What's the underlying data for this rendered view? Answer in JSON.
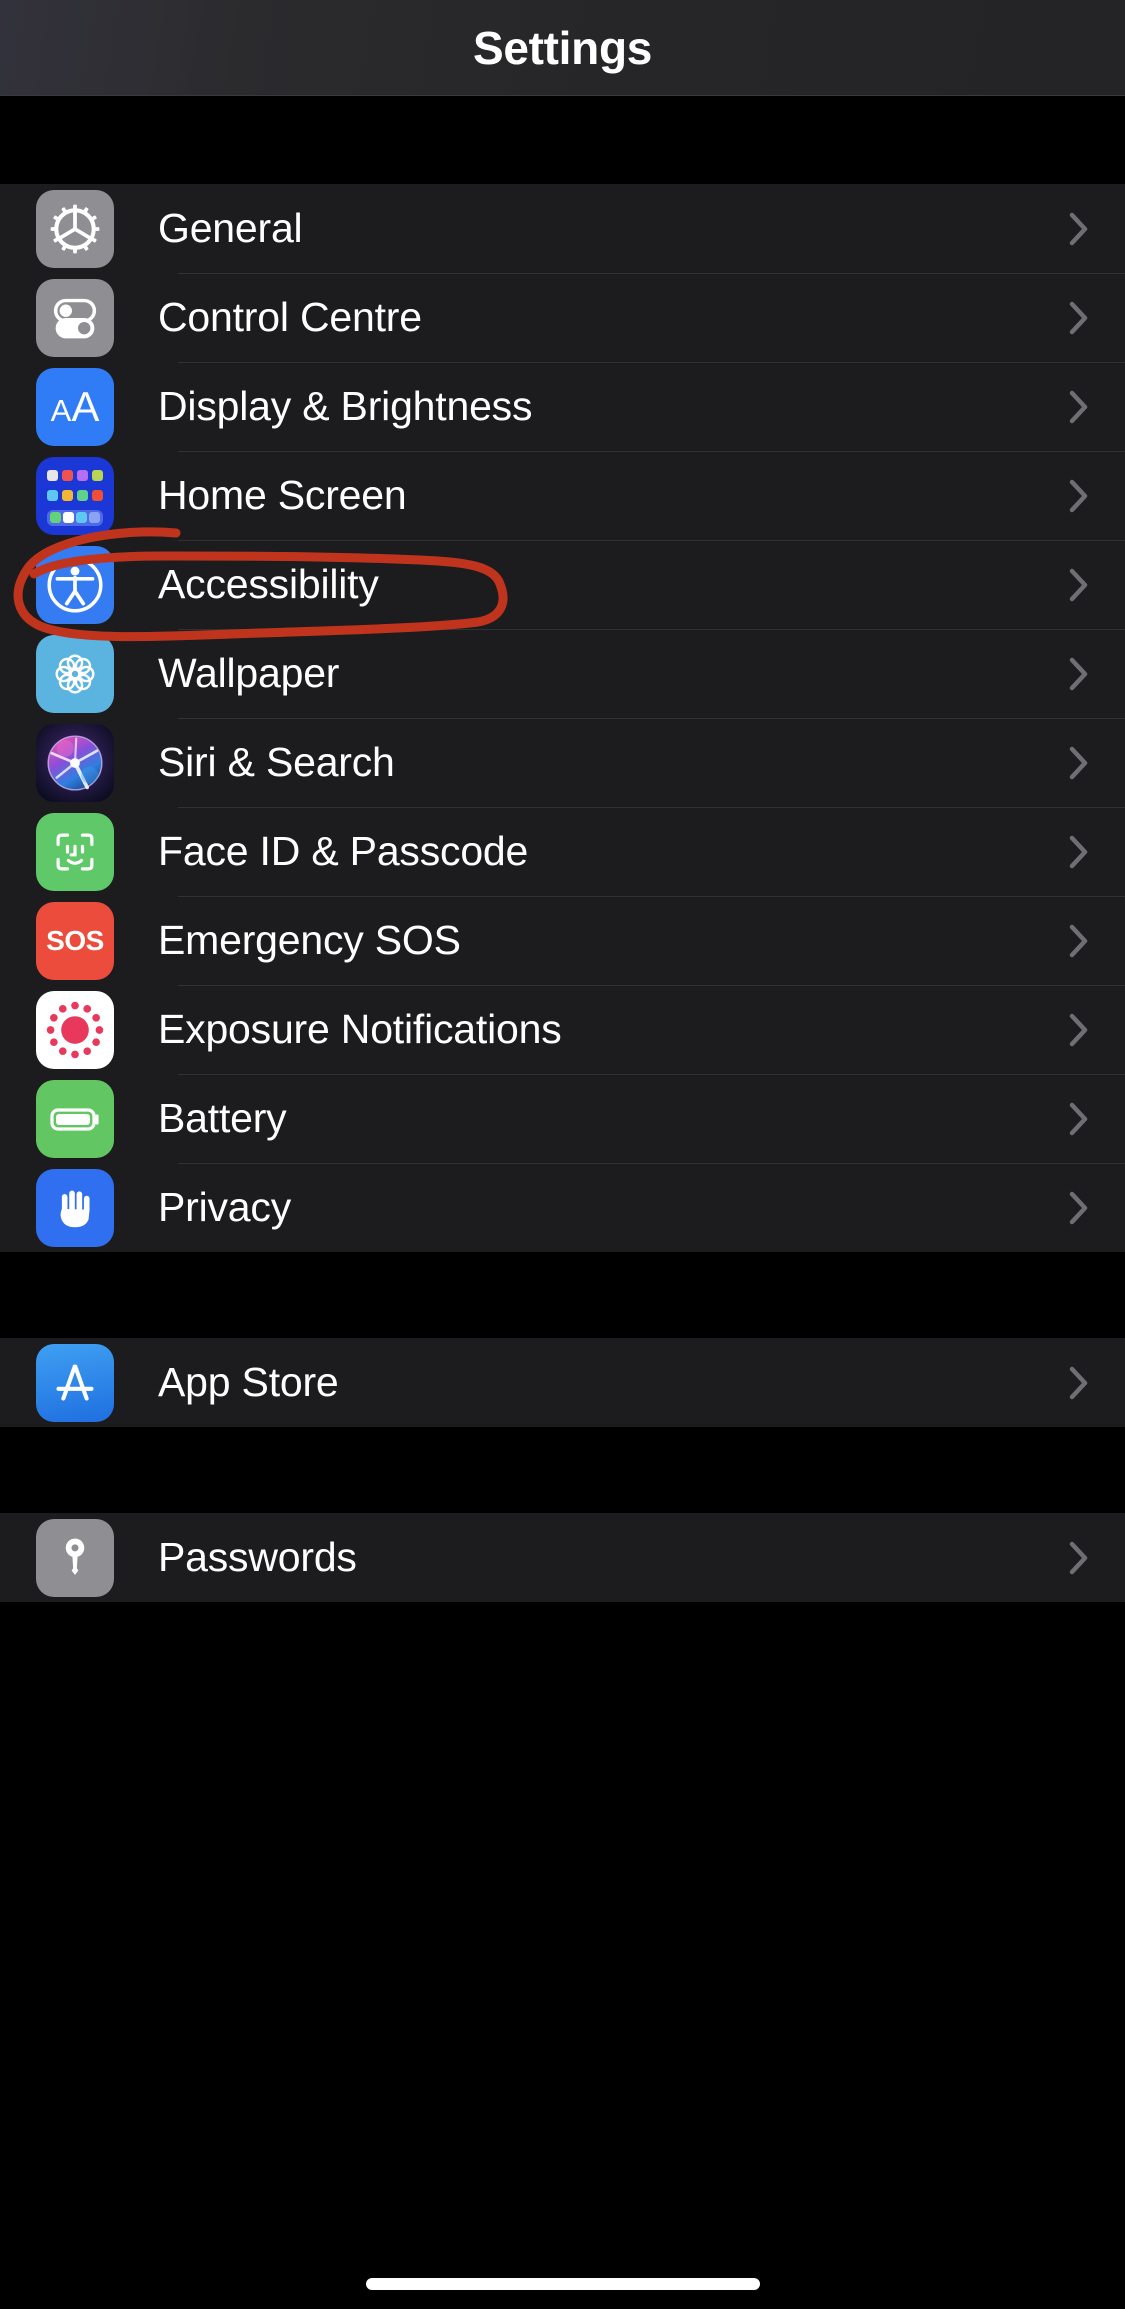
{
  "header": {
    "title": "Settings"
  },
  "colors": {
    "background": "#000000",
    "row_background": "#1c1c1e",
    "separator": "#313134",
    "label_text": "#ffffff",
    "chevron": "#6e6e73",
    "annotation_red": "#c0341d",
    "accent_blue": "#2f7cf6",
    "gray_icon": "#8e8e93",
    "green_icon": "#5fc96a",
    "red_icon": "#ec4c3b"
  },
  "groups": [
    {
      "name": "system-group",
      "rows": [
        {
          "label": "General",
          "icon": "gear-icon",
          "icon_class": "ic-general",
          "chevron": true
        },
        {
          "label": "Control Centre",
          "icon": "toggles-icon",
          "icon_class": "ic-control",
          "chevron": true
        },
        {
          "label": "Display & Brightness",
          "icon": "display-brightness-icon",
          "icon_class": "ic-display",
          "chevron": true
        },
        {
          "label": "Home Screen",
          "icon": "home-screen-grid-icon",
          "icon_class": "ic-home",
          "chevron": true
        },
        {
          "label": "Accessibility",
          "icon": "accessibility-person-icon",
          "icon_class": "ic-access",
          "chevron": true
        },
        {
          "label": "Wallpaper",
          "icon": "wallpaper-flower-icon",
          "icon_class": "ic-wallpaper",
          "chevron": true
        },
        {
          "label": "Siri & Search",
          "icon": "siri-orb-icon",
          "icon_class": "ic-siri",
          "chevron": true
        },
        {
          "label": "Face ID & Passcode",
          "icon": "face-id-icon",
          "icon_class": "ic-faceid",
          "chevron": true
        },
        {
          "label": "Emergency SOS",
          "icon": "sos-icon",
          "icon_class": "ic-sos",
          "chevron": true
        },
        {
          "label": "Exposure Notifications",
          "icon": "exposure-notifications-icon",
          "icon_class": "ic-exposure",
          "chevron": true
        },
        {
          "label": "Battery",
          "icon": "battery-icon",
          "icon_class": "ic-battery",
          "chevron": true
        },
        {
          "label": "Privacy",
          "icon": "privacy-hand-icon",
          "icon_class": "ic-privacy",
          "chevron": true
        }
      ]
    },
    {
      "name": "store-group",
      "rows": [
        {
          "label": "App Store",
          "icon": "app-store-icon",
          "icon_class": "ic-appstore",
          "chevron": true
        }
      ]
    },
    {
      "name": "passwords-group",
      "rows": [
        {
          "label": "Passwords",
          "icon": "key-icon",
          "icon_class": "ic-passwords",
          "chevron": true
        }
      ]
    }
  ],
  "annotation": {
    "type": "hand-drawn-oval",
    "target_row": "Accessibility",
    "color": "#c0341d",
    "stroke_width": 9
  },
  "icon_text": {
    "sos": "SOS",
    "display_small_a": "A",
    "display_large_a": "A"
  },
  "home_indicator": {
    "visible": true
  }
}
